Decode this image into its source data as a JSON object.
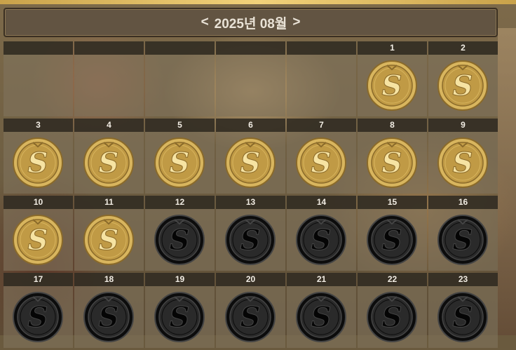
{
  "calendar": {
    "prev_label": "<",
    "title": "2025년 08월",
    "next_label": ">"
  },
  "weeks": [
    [
      {
        "day": "",
        "coin": "none"
      },
      {
        "day": "",
        "coin": "none"
      },
      {
        "day": "",
        "coin": "none"
      },
      {
        "day": "",
        "coin": "none"
      },
      {
        "day": "",
        "coin": "none"
      },
      {
        "day": "1",
        "coin": "gold"
      },
      {
        "day": "2",
        "coin": "gold"
      }
    ],
    [
      {
        "day": "3",
        "coin": "gold"
      },
      {
        "day": "4",
        "coin": "gold"
      },
      {
        "day": "5",
        "coin": "gold"
      },
      {
        "day": "6",
        "coin": "gold"
      },
      {
        "day": "7",
        "coin": "gold"
      },
      {
        "day": "8",
        "coin": "gold"
      },
      {
        "day": "9",
        "coin": "gold"
      }
    ],
    [
      {
        "day": "10",
        "coin": "gold"
      },
      {
        "day": "11",
        "coin": "gold"
      },
      {
        "day": "12",
        "coin": "dark"
      },
      {
        "day": "13",
        "coin": "dark"
      },
      {
        "day": "14",
        "coin": "dark"
      },
      {
        "day": "15",
        "coin": "dark"
      },
      {
        "day": "16",
        "coin": "dark"
      }
    ],
    [
      {
        "day": "17",
        "coin": "dark"
      },
      {
        "day": "18",
        "coin": "dark"
      },
      {
        "day": "19",
        "coin": "dark"
      },
      {
        "day": "20",
        "coin": "dark"
      },
      {
        "day": "21",
        "coin": "dark"
      },
      {
        "day": "22",
        "coin": "dark"
      },
      {
        "day": "23",
        "coin": "dark"
      }
    ]
  ],
  "colors": {
    "gold_rim": "#d8b55e",
    "gold_face": "#c09a45",
    "gold_letter": "#f6e3a2",
    "dark_rim": "#0c0c0c",
    "dark_face": "#2a2a2a",
    "dark_letter": "#050505"
  }
}
